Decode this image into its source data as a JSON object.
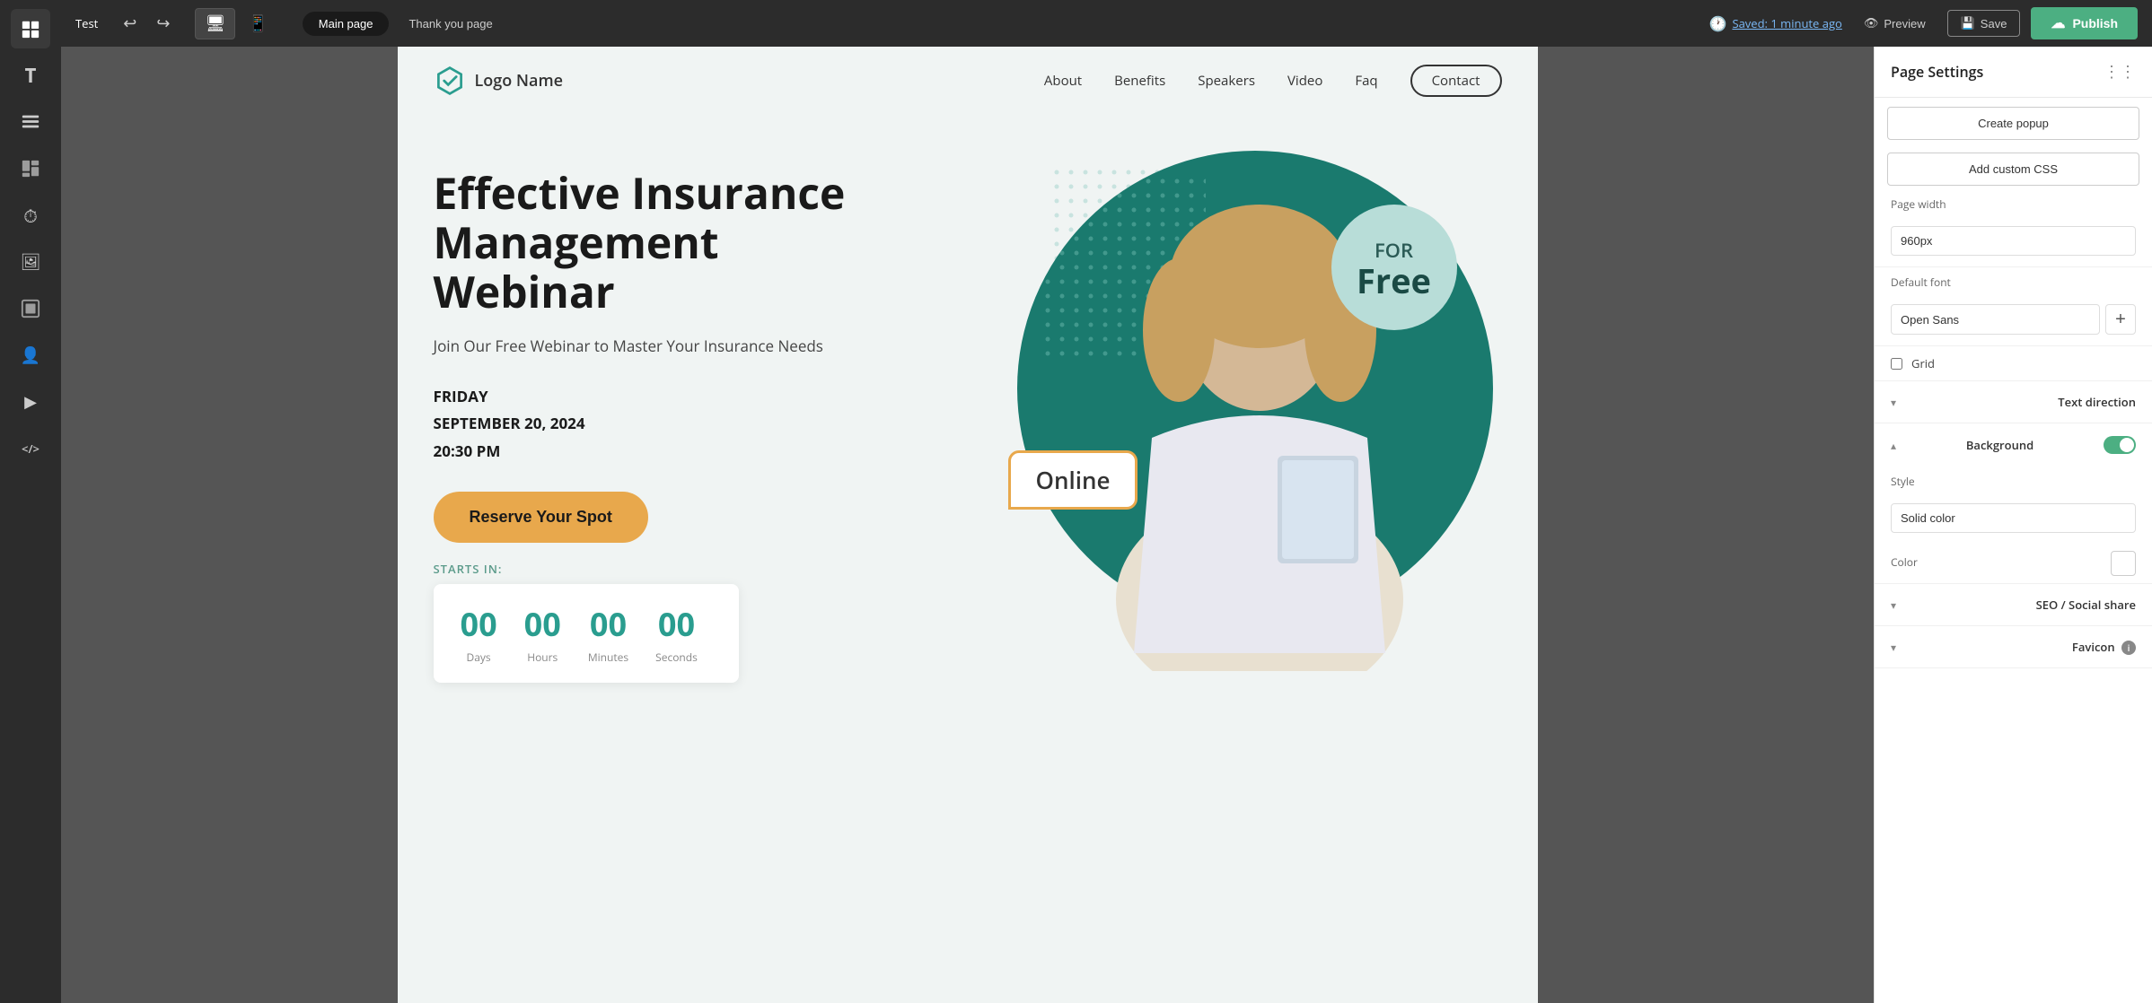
{
  "app": {
    "project_name": "Test"
  },
  "top_bar": {
    "project_label": "Test",
    "page_tabs": [
      {
        "id": "main",
        "label": "Main page",
        "active": true
      },
      {
        "id": "thankyou",
        "label": "Thank you page",
        "active": false
      }
    ],
    "saved_text": "Saved: 1 minute ago",
    "preview_label": "Preview",
    "save_label": "Save",
    "publish_label": "Publish"
  },
  "nav": {
    "logo_name": "Logo Name",
    "links": [
      "About",
      "Benefits",
      "Speakers",
      "Video",
      "Faq"
    ],
    "cta": "Contact"
  },
  "hero": {
    "title": "Effective Insurance Management Webinar",
    "subtitle": "Join Our Free Webinar to Master Your Insurance Needs",
    "date_line1": "FRIDAY",
    "date_line2": "SEPTEMBER 20, 2024",
    "date_line3": "20:30 PM",
    "cta_label": "Reserve Your Spot",
    "starts_in_label": "STARTS IN:",
    "badge_for": "FOR",
    "badge_free": "Free",
    "online_label": "Online",
    "countdown": {
      "days": "00",
      "hours": "00",
      "minutes": "00",
      "seconds": "00",
      "days_label": "Days",
      "hours_label": "Hours",
      "minutes_label": "Minutes",
      "seconds_label": "Seconds"
    }
  },
  "right_panel": {
    "title": "Page Settings",
    "create_popup_label": "Create popup",
    "add_css_label": "Add custom CSS",
    "page_width_label": "Page width",
    "page_width_value": "960px",
    "default_font_label": "Default font",
    "default_font_value": "Open Sans",
    "grid_label": "Grid",
    "text_direction_label": "Text direction",
    "background_label": "Background",
    "style_label": "Style",
    "style_value": "Solid color",
    "color_label": "Color",
    "seo_label": "SEO / Social share",
    "favicon_label": "Favicon"
  },
  "icons": {
    "undo": "↩",
    "redo": "↪",
    "desktop": "🖥",
    "mobile": "📱",
    "eye": "👁",
    "save_floppy": "💾",
    "publish_arrow": "↑",
    "chevron_down": "▾",
    "chevron_up": "▴",
    "menu_dots": "⋮",
    "grid_icon": "⊞",
    "text_icon": "T",
    "layers_icon": "≡",
    "shape_icon": "□",
    "timer_icon": "⏱",
    "image_icon": "🖼",
    "section_icon": "⊟",
    "user_icon": "👤",
    "video_icon": "▶",
    "code_icon": "</>",
    "logo_shield": "shield"
  },
  "colors": {
    "teal": "#2a9d8f",
    "dark_teal": "#1a7a6e",
    "light_teal_badge": "#b8ddd8",
    "orange_cta": "#e8a84c",
    "background": "#f0f4f3",
    "white": "#ffffff",
    "publish_green": "#4caf82",
    "toggle_on": "#4caf82"
  }
}
